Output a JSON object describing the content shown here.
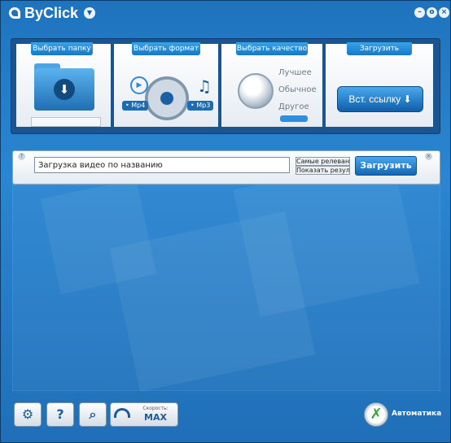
{
  "app": {
    "title": "ByClick"
  },
  "window_controls": {
    "minimize": "–",
    "restore": "o",
    "close": "×"
  },
  "top": {
    "folder_label": "Выбрать папку",
    "format_label": "Выбрать формат",
    "format_left": "Mp4",
    "format_right": "Mp3",
    "quality_label": "Выбрать качество",
    "quality_options": [
      "Лучшее",
      "Обычное",
      "Другое"
    ],
    "download_label": "Загрузить",
    "insert_link": "Вст. ссылку ⬇"
  },
  "search": {
    "placeholder": "Загрузка видео по названию",
    "sort_select": "Самые релевантн",
    "results_select": "Показать резуль",
    "button": "Загрузить",
    "help": "?",
    "close": "×"
  },
  "bottom": {
    "speed_label": "Скорость:",
    "speed_value": "MAX",
    "auto_label": "Автоматика"
  },
  "colors": {
    "accent": "#1f73bd",
    "panel": "#1a5592",
    "button": "#1268b5"
  }
}
